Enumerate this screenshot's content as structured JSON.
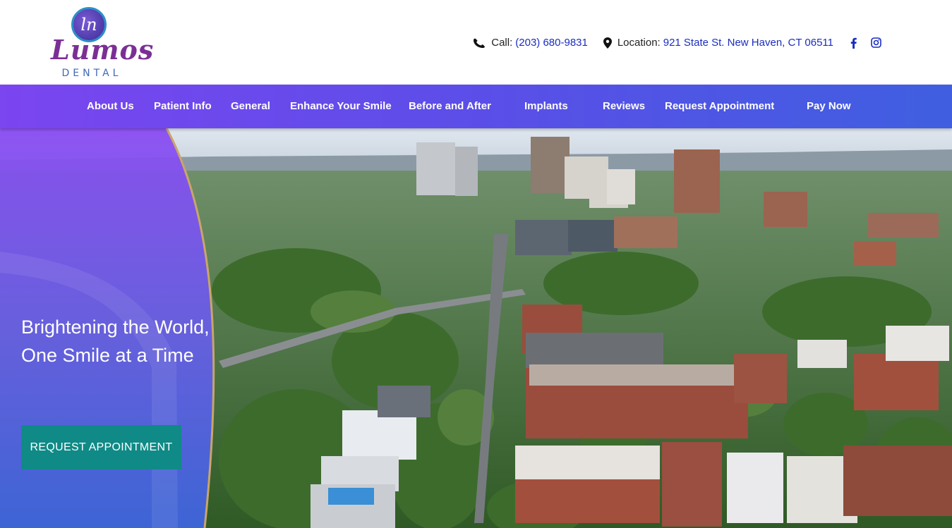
{
  "brand": {
    "logo_initials": "ln",
    "name": "Lumos",
    "sub": "DENTAL"
  },
  "contact": {
    "call_label": "Call:",
    "phone": "(203) 680-9831",
    "location_label": "Location:",
    "address": "921 State St. New Haven, CT 06511"
  },
  "nav": {
    "items": [
      {
        "label": "About Us"
      },
      {
        "label": "Patient Info"
      },
      {
        "label": "General"
      },
      {
        "label": "Enhance Your Smile"
      },
      {
        "label": "Before and After"
      },
      {
        "label": "Implants"
      },
      {
        "label": "Reviews"
      },
      {
        "label": "Request Appointment"
      },
      {
        "label": "Pay Now"
      }
    ]
  },
  "hero": {
    "tagline": "Brightening the World, One Smile at a Time",
    "cta_label": "REQUEST APPOINTMENT"
  },
  "colors": {
    "nav_start": "#7b45f0",
    "nav_end": "#3f5fe0",
    "cta": "#0f8a86",
    "link": "#1a2dbf",
    "accent_curve": "#c9a56a"
  },
  "icons": [
    "phone-icon",
    "map-pin-icon",
    "facebook-icon",
    "instagram-icon"
  ]
}
